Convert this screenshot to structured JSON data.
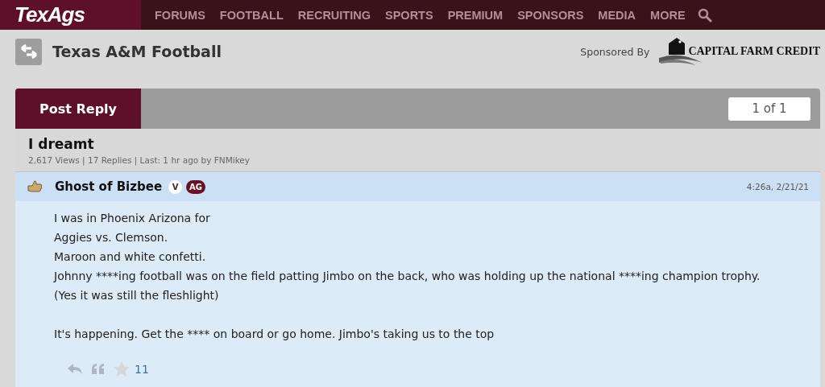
{
  "site": {
    "logo": "TexAgs",
    "nav": [
      "FORUMS",
      "FOOTBALL",
      "RECRUITING",
      "SPORTS",
      "PREMIUM",
      "SPONSORS",
      "MEDIA",
      "MORE"
    ]
  },
  "forum": {
    "title": "Texas A&M Football",
    "sponsored_label": "Sponsored By",
    "sponsor": "CAPITAL FARM CREDIT"
  },
  "thread": {
    "post_reply": "Post Reply",
    "page": "1 of 1",
    "title": "I dreamt",
    "stats": "2,617 Views | 17 Replies | Last: 1 hr ago by FNMikey"
  },
  "post": {
    "author": "Ghost of Bizbee",
    "badges": [
      "V",
      "AG"
    ],
    "time": "4:26a, 2/21/21",
    "paragraphs": [
      [
        "I was in Phoenix Arizona for",
        "Aggies vs. Clemson.",
        "Maroon and white confetti.",
        "Johnny ****ing football was on the field patting Jimbo on the back, who was holding up the national ****ing champion trophy. (Yes it was still the fleshlight)"
      ],
      [
        "It's happening. Get the **** on board or go home. Jimbo's taking us to the top"
      ]
    ],
    "star_count": "11"
  }
}
